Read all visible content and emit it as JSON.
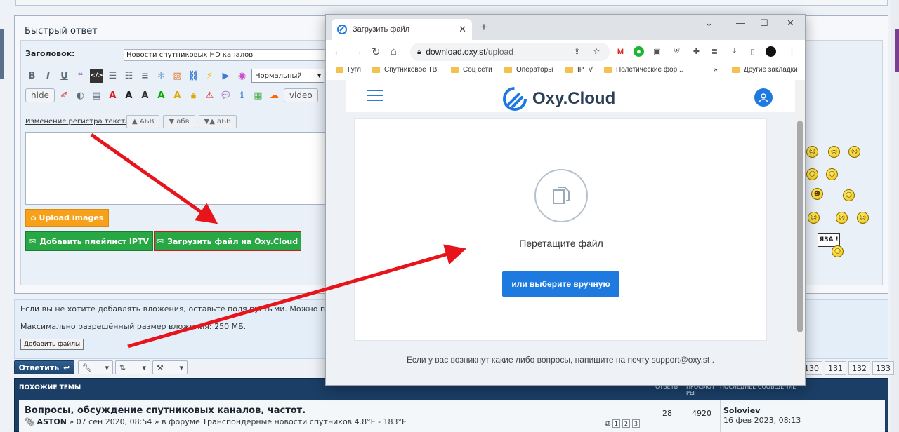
{
  "forum": {
    "quick_reply_title": "Быстрый ответ",
    "subject_label": "Заголовок:",
    "subject_value": "Новости спутниковых HD каналов",
    "format_select": "Нормальный",
    "hide_btn": "hide",
    "video_btn": "video",
    "case_label": "Изменение регистра текста:",
    "case_buttons": [
      "▲ АБВ",
      "▼ абв",
      "▼▲ аБВ"
    ],
    "upload_images": "Upload images",
    "add_playlist": "Добавить плейлист IPTV",
    "upload_oxy": "Загрузить файл на Oxy.Cloud",
    "info_line1": "Если вы не хотите добавлять вложения, оставьте поля пустыми. Можно прикрепл",
    "info_line2": "Максимально разрешённый размер вложения: 250 МБ.",
    "add_files": "Добавить файлы",
    "reply_btn": "Ответить",
    "pages": [
      "130",
      "131",
      "132",
      "133"
    ],
    "sign_text": "ЯЗА !"
  },
  "topics": {
    "title": "ПОХОЖИЕ ТЕМЫ",
    "col_replies": "ОТВЕТЫ",
    "col_views": "ПРОСМОТ\nРЫ",
    "col_last": "ПОСЛЕДНЕЕ СООБЩЕНИЕ",
    "row": {
      "title": "Вопросы, обсуждение спутниковых каналов, частот.",
      "author": "ASTON",
      "meta": " » 07 сен 2020, 08:54 » в форуме Транспондерные новости спутников 4.8°E - 183°E",
      "pages": [
        "1",
        "2",
        "3"
      ],
      "replies": "28",
      "views": "4920",
      "last_user": "Soloviev",
      "last_date": "16 фев 2023, 08:13"
    }
  },
  "browser": {
    "tab_title": "Загрузить файл",
    "url_host": "download.oxy.st",
    "url_path": "/upload",
    "bookmarks": [
      "Гугл",
      "Спутниковое ТВ",
      "Соц сети",
      "Операторы",
      "IPTV",
      "Полетические фор...",
      "»",
      "Другие закладки"
    ]
  },
  "site": {
    "logo_text": "Oxy.Cloud",
    "drag_text": "Перетащите файл",
    "choose_btn": "или выберите вручную",
    "footer": "Если у вас возникнут какие либо вопросы, напишите на почту support@oxy.st ."
  },
  "colors": {
    "accent_blue": "#1f7ae0",
    "green_btn": "#27a844",
    "orange_btn": "#f7a11a",
    "arrow_red": "#e8141b",
    "forum_navy": "#1b3e66"
  }
}
